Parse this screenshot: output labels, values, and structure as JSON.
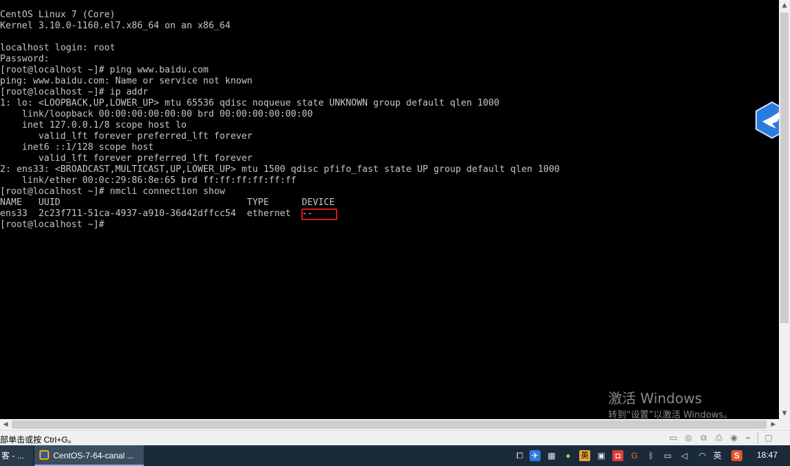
{
  "terminal": {
    "lines": [
      "CentOS Linux 7 (Core)",
      "Kernel 3.10.0-1160.el7.x86_64 on an x86_64",
      "",
      "localhost login: root",
      "Password:",
      "[root@localhost ~]# ping www.baidu.com",
      "ping: www.baidu.com: Name or service not known",
      "[root@localhost ~]# ip addr",
      "1: lo: <LOOPBACK,UP,LOWER_UP> mtu 65536 qdisc noqueue state UNKNOWN group default qlen 1000",
      "    link/loopback 00:00:00:00:00:00 brd 00:00:00:00:00:00",
      "    inet 127.0.0.1/8 scope host lo",
      "       valid_lft forever preferred_lft forever",
      "    inet6 ::1/128 scope host",
      "       valid_lft forever preferred_lft forever",
      "2: ens33: <BROADCAST,MULTICAST,UP,LOWER_UP> mtu 1500 qdisc pfifo_fast state UP group default qlen 1000",
      "    link/ether 00:0c:29:86:8e:65 brd ff:ff:ff:ff:ff:ff",
      "[root@localhost ~]# nmcli connection show",
      "NAME   UUID                                  TYPE      DEVICE",
      "ens33  2c23f711-51ca-4937-a910-36d42dffcc54  ethernet  --",
      "[root@localhost ~]#"
    ],
    "highlight_color": "#e0141c"
  },
  "watermark": {
    "title": "激活 Windows",
    "subtitle": "转到“设置”以激活 Windows。"
  },
  "statusbar": {
    "hint": "部单击或按 Ctrl+G。",
    "icons": [
      "hard-disk-icon",
      "cd-icon",
      "network-icon",
      "printer-icon",
      "sound-icon",
      "message-icon"
    ]
  },
  "taskbar": {
    "prev_task_label": "客 - ...",
    "active_task_label": "CentOS-7-64-canal ...",
    "tray": {
      "ime_label": "英",
      "ime2_label": "英",
      "clock": "18:47"
    }
  },
  "colors": {
    "terminal_bg": "#000000",
    "terminal_fg": "#c6c6c6",
    "taskbar_bg": "#1b2a38",
    "statusbar_bg": "#f0f0f0"
  }
}
